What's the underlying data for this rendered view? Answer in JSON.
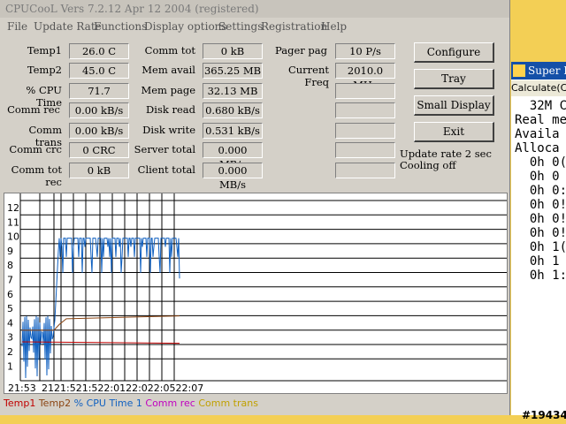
{
  "window": {
    "title": "CPUCooL  Vers 7.2.12  Apr 12 2004 (registered)"
  },
  "menu": [
    {
      "label": "File"
    },
    {
      "label": "Update Rate"
    },
    {
      "label": "Functions"
    },
    {
      "label": "Display options"
    },
    {
      "label": "Settings"
    },
    {
      "label": "Registration"
    },
    {
      "label": "Help"
    }
  ],
  "stats": {
    "col1": [
      {
        "label": "Temp1",
        "value": "26.0 C"
      },
      {
        "label": "Temp2",
        "value": "45.0 C"
      },
      {
        "label": "% CPU Time",
        "value": "71.7"
      },
      {
        "label": "Comm rec",
        "value": "0.00 kB/s"
      },
      {
        "label": "Comm trans",
        "value": "0.00 kB/s"
      },
      {
        "label": "Comm crc",
        "value": "0 CRC"
      },
      {
        "label": "Comm tot rec",
        "value": "0 kB"
      }
    ],
    "col2": [
      {
        "label": "Comm tot",
        "value": "0 kB"
      },
      {
        "label": "Mem avail",
        "value": "365.25 MB"
      },
      {
        "label": "Mem page",
        "value": "32.13 MB"
      },
      {
        "label": "Disk read",
        "value": "0.680 kB/s"
      },
      {
        "label": "Disk write",
        "value": "0.531 kB/s"
      },
      {
        "label": "Server total",
        "value": "0.000 MB/s"
      },
      {
        "label": "Client total",
        "value": "0.000 MB/s"
      }
    ],
    "col3": [
      {
        "label": "Pager pag",
        "value": "10 P/s"
      },
      {
        "label": "Current Freq",
        "value": "2010.0 MHz"
      },
      {
        "label": "",
        "value": ""
      },
      {
        "label": "",
        "value": ""
      },
      {
        "label": "",
        "value": ""
      },
      {
        "label": "",
        "value": ""
      },
      {
        "label": "",
        "value": ""
      }
    ]
  },
  "buttons": {
    "configure": "Configure",
    "tray": "Tray",
    "small_display": "Small Display",
    "exit": "Exit"
  },
  "status": {
    "update_rate": "Update rate 2 sec",
    "cooling": "Cooling off"
  },
  "graph": {
    "y_ticks": [
      "12",
      "11",
      "10",
      "9",
      "8",
      "7",
      "6",
      "5",
      "4",
      "3",
      "2",
      "1"
    ],
    "x_labels": [
      "21:53",
      "2121:521:522:0122:022:0522:07"
    ]
  },
  "legend": [
    {
      "label": "Temp1",
      "color": "#c00000"
    },
    {
      "label": "Temp2",
      "color": "#8b4513"
    },
    {
      "label": "% CPU Time 1",
      "color": "#1060c0"
    },
    {
      "label": "Comm rec",
      "color": "#c000c0"
    },
    {
      "label": "Comm trans",
      "color": "#c0a000"
    }
  ],
  "side_window": {
    "title": "Super PI",
    "menu": "Calculate(C",
    "lines": [
      "  32M C",
      "Real me",
      "Availa",
      "Alloca",
      "  0h 0(",
      "  0h 0",
      "  0h 0:",
      "  0h 0!",
      "  0h 0!",
      "  0h 0!",
      "  0h 1(",
      "  0h 1",
      "  0h 1:"
    ]
  },
  "watermark": "#19434"
}
